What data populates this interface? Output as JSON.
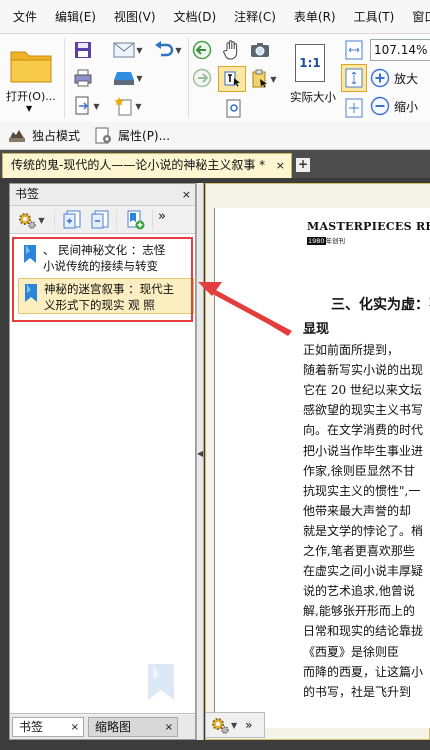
{
  "menubar": {
    "items": [
      "文件",
      "编辑(E)",
      "视图(V)",
      "文档(D)",
      "注释(C)",
      "表单(R)",
      "工具(T)",
      "窗口"
    ]
  },
  "ribbon": {
    "open_label": "打开(O)...",
    "actual_size_label": "实际大小",
    "actual_size_icon_text": "1:1",
    "zoom_value": "107.14%",
    "zoom_in_label": "放大",
    "zoom_out_label": "缩小"
  },
  "quickbar": {
    "exclusive_mode": "独占模式",
    "properties": "属性(P)..."
  },
  "document_tab": {
    "title": "传统的鬼-现代的人——论小说的神秘主义叙事 *",
    "close": "×",
    "add": "+"
  },
  "bookmark_panel": {
    "title": "书签",
    "close": "×",
    "items": [
      {
        "line1": "、 民间神秘文化 ：志怪",
        "line2": "小说传统的接续与转变",
        "selected": false
      },
      {
        "line1": "神秘的迷宫叙事 ：现代主",
        "line2": "义形式下的现实  观 照",
        "selected": true
      }
    ],
    "tabs": [
      {
        "label": "书签",
        "close": "×"
      },
      {
        "label": "缩略图",
        "close": "×"
      }
    ]
  },
  "page": {
    "magazine_title": "MASTERPIECES REVIEW",
    "magazine_year": "1980",
    "magazine_sub": "年创刊",
    "section_title": "三、化实为虚：不",
    "section_title_2": "显现",
    "lines": [
      "      正如前面所提到，",
      "随着新写实小说的出现",
      "它在 20 世纪以来文坛",
      "感欲望的现实主义书写",
      "向。在文学消费的时代",
      "把小说当作毕生事业进",
      "作家,徐则臣显然不甘",
      "抗现实主义的惯性\",一",
      "他带来最大声誉的却",
      "就是文学的悖论了。梢",
      "之作,笔者更喜欢那些",
      "在虚实之间小说丰厚疑",
      "说的艺术追求,他曾说",
      "解,能够张开形而上的",
      "日常和现实的结论靠拢",
      "      《西夏》是徐则臣",
      "而降的西夏，让这篇小",
      "的书写，社是飞升到"
    ]
  },
  "colors": {
    "highlight": "#e43d3d",
    "tab_active": "#fdf6d0",
    "bookmark_blue": "#2b86d9"
  }
}
